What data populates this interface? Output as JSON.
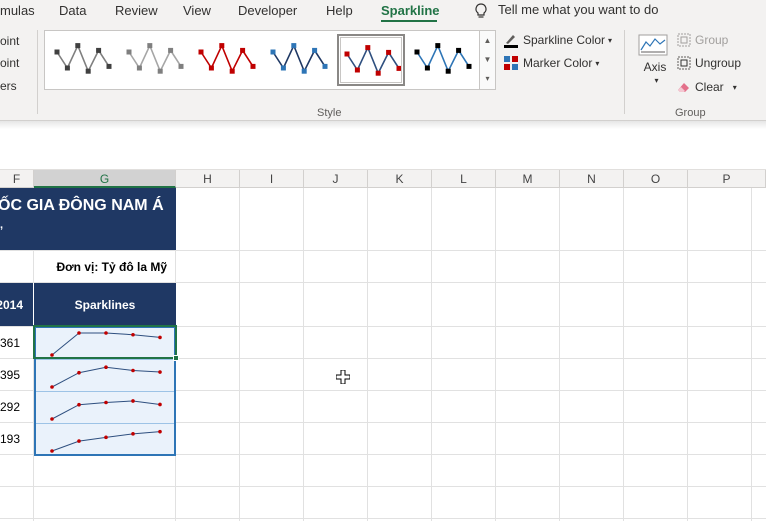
{
  "ribbon": {
    "tabs": [
      "mulas",
      "Data",
      "Review",
      "View",
      "Developer",
      "Help",
      "Sparkline"
    ],
    "active_tab": "Sparkline",
    "tell_me": "Tell me what you want to do",
    "left_items": [
      "oint",
      "oint",
      "ers"
    ],
    "style_group_label": "Style",
    "sparkline_color": "Sparkline Color",
    "marker_color": "Marker Color",
    "axis": "Axis",
    "group": "Group",
    "ungroup": "Ungroup",
    "clear": "Clear",
    "group_group_label": "Group",
    "gallery_styles": [
      {
        "line": "#7f7f7f",
        "marker": "#404040"
      },
      {
        "line": "#a6a6a6",
        "marker": "#7f7f7f"
      },
      {
        "line": "#c00000",
        "marker": "#c00000"
      },
      {
        "line": "#1f3864",
        "marker": "#2e75b6"
      },
      {
        "line": "#2e4f7f",
        "marker": "#c00000"
      },
      {
        "line": "#2e75b6",
        "marker": "#000000"
      }
    ],
    "selected_style": 4
  },
  "columns": [
    "F",
    "G",
    "H",
    "I",
    "J",
    "K",
    "L",
    "M",
    "N",
    "O",
    "P"
  ],
  "selected_column": "G",
  "sheet": {
    "title": "ỐC GIA ĐÔNG NAM Á",
    "unit": "Đơn vị: Tỷ đô la Mỹ",
    "col_f_header": "2014",
    "col_g_header": "Sparklines",
    "col_f_values": [
      "361",
      "395",
      "292",
      "193"
    ],
    "sparklines": [
      [
        0.0,
        1.0,
        1.0,
        0.92,
        0.8
      ],
      [
        0.0,
        0.65,
        0.9,
        0.75,
        0.68
      ],
      [
        0.0,
        0.65,
        0.75,
        0.82,
        0.66
      ],
      [
        0.0,
        0.45,
        0.62,
        0.78,
        0.88
      ]
    ],
    "spark_line_color": "#2e4f7f",
    "spark_marker_color": "#c00000"
  }
}
